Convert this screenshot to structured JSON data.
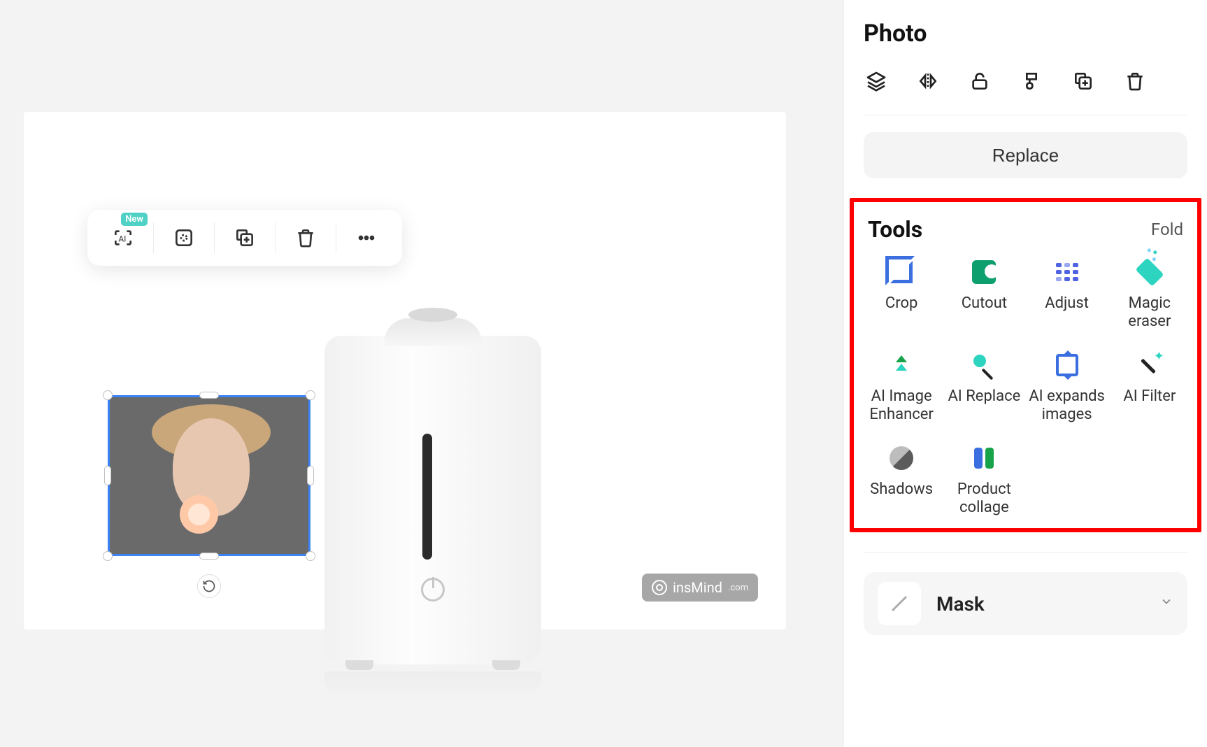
{
  "panel": {
    "title": "Photo",
    "replace_label": "Replace",
    "actions": [
      "layers",
      "flip",
      "unlock",
      "style",
      "duplicate",
      "delete"
    ]
  },
  "tools": {
    "title": "Tools",
    "fold_label": "Fold",
    "items": [
      {
        "name": "Crop"
      },
      {
        "name": "Cutout"
      },
      {
        "name": "Adjust"
      },
      {
        "name": "Magic eraser"
      },
      {
        "name": "AI Image Enhancer"
      },
      {
        "name": "AI Replace"
      },
      {
        "name": "AI expands images"
      },
      {
        "name": "AI Filter"
      },
      {
        "name": "Shadows"
      },
      {
        "name": "Product collage"
      }
    ]
  },
  "mask": {
    "label": "Mask"
  },
  "floating_toolbar": {
    "badge": "New",
    "items": [
      "ai-tools",
      "select-similar",
      "duplicate",
      "delete",
      "more"
    ]
  },
  "watermark": {
    "brand": "insMind",
    "domain": ".com"
  }
}
